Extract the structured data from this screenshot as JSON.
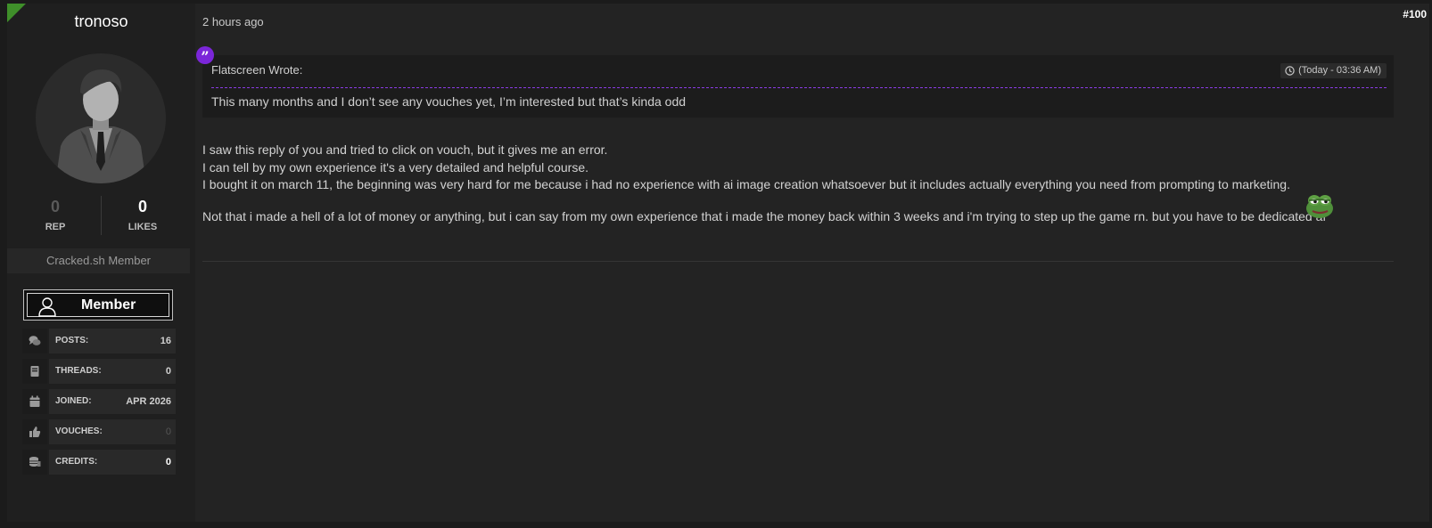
{
  "author": {
    "username": "tronoso",
    "stats": {
      "rep_value": "0",
      "rep_label": "REP",
      "likes_value": "0",
      "likes_label": "LIKES"
    },
    "usergroup": "Cracked.sh Member",
    "badge_label": "Member",
    "info": [
      {
        "icon": "chat-bubbles-icon",
        "label": "POSTS:",
        "value": "16"
      },
      {
        "icon": "book-icon",
        "label": "THREADS:",
        "value": "0"
      },
      {
        "icon": "calendar-icon",
        "label": "JOINED:",
        "value": "APR 2026"
      },
      {
        "icon": "thumbs-up-icon",
        "label": "VOUCHES:",
        "value": "0"
      },
      {
        "icon": "coins-icon",
        "label": "CREDITS:",
        "value": "0"
      }
    ]
  },
  "post": {
    "timestamp": "2 hours ago",
    "number": "#100",
    "quote": {
      "author": "Flatscreen Wrote:",
      "time": "(Today - 03:36 AM)",
      "text": "This many months and I don’t see any vouches yet, I’m interested but that’s kinda odd"
    },
    "paragraph_1": [
      "I saw this reply of you and tried to click on vouch, but it gives me an error.",
      "I can tell by my own experience it's a very detailed and helpful course.",
      "I bought it on march 11, the beginning was very hard for me because i had no experience with ai image creation whatsoever but it includes actually everything you need from prompting to marketing."
    ],
    "paragraph_2": "Not that i made a hell of a lot of money or anything, but i can say from my own experience that i made the money back within 3 weeks and i'm trying to step up the game rn. but you have to be dedicated af"
  },
  "colors": {
    "accent_purple": "#7b26d9",
    "flag_green": "#3f8f2a",
    "background": "#1b1b1b"
  }
}
